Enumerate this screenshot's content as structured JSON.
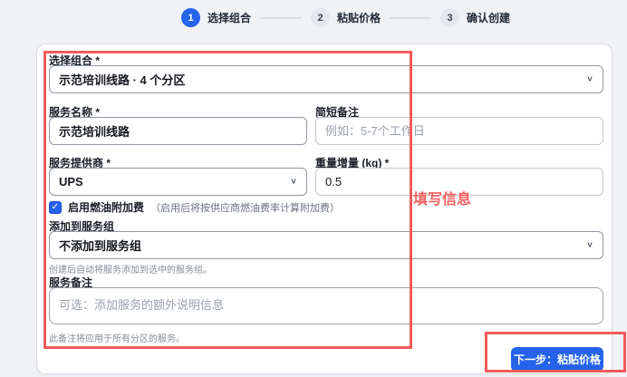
{
  "stepper": {
    "steps": [
      {
        "number": "1",
        "label": "选择组合"
      },
      {
        "number": "2",
        "label": "粘贴价格"
      },
      {
        "number": "3",
        "label": "确认创建"
      }
    ]
  },
  "form": {
    "combo_label": "选择组合 *",
    "combo_value": "示范培训线路 · 4 个分区",
    "service_name_label": "服务名称 *",
    "service_name_value": "示范培训线路",
    "short_note_label": "简短备注",
    "short_note_placeholder": "例如：5-7个工作日",
    "provider_label": "服务提供商 *",
    "provider_value": "UPS",
    "weight_label": "重量增量 (kg) *",
    "weight_value": "0.5",
    "fuel_label": "启用燃油附加费",
    "fuel_hint": "（启用后将按供应商燃油费率计算附加费）",
    "group_label": "添加到服务组",
    "group_value": "不添加到服务组",
    "group_hint": "创建后自动将服务添加到选中的服务组。",
    "remark_label": "服务备注",
    "remark_placeholder": "可选：添加服务的额外说明信息",
    "remark_hint": "此备注将应用于所有分区的服务。"
  },
  "footer": {
    "next_button_label": "下一步：粘贴价格"
  },
  "annotations": {
    "note_text": "填写信息",
    "highlight_color": "#f15b5b"
  },
  "colors": {
    "accent_blue": "#2563eb",
    "page_background": "#f0f2f5"
  },
  "icons": {
    "check": "✓",
    "chevron_down": "∨"
  }
}
